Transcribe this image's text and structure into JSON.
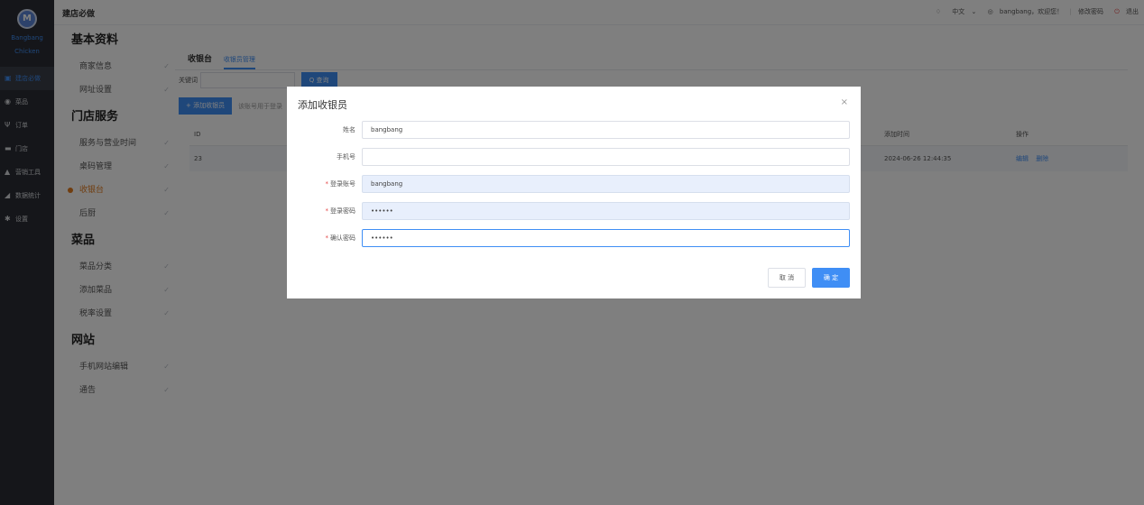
{
  "nav": {
    "brand_mark": "M",
    "brand_name_1": "Bangbang",
    "brand_name_2": "Chicken",
    "items": [
      {
        "icon": "clipboard-icon",
        "glyph": "▣",
        "label": "建店必做"
      },
      {
        "icon": "dish-icon",
        "glyph": "◉",
        "label": "菜品"
      },
      {
        "icon": "utensils-icon",
        "glyph": "Ψ",
        "label": "订单"
      },
      {
        "icon": "store-icon",
        "glyph": "▬",
        "label": "门店"
      },
      {
        "icon": "thumbs-up-icon",
        "glyph": "▲",
        "label": "营销工具"
      },
      {
        "icon": "stats-icon",
        "glyph": "◢",
        "label": "数据统计"
      },
      {
        "icon": "gear-icon",
        "glyph": "✱",
        "label": "设置"
      }
    ]
  },
  "topbar": {
    "title": "建店必做",
    "bell_glyph": "♢",
    "language": "中文",
    "chevron_glyph": "⌄",
    "user_glyph": "◎",
    "greeting": "bangbang，欢迎您！",
    "separator": "|",
    "change_password": "修改密码",
    "logout_glyph": "⏻",
    "logout": "退出"
  },
  "submenu": {
    "check_glyph": "✓",
    "groups": [
      {
        "title": "基本资料",
        "items": [
          "商家信息",
          "网址设置"
        ]
      },
      {
        "title": "门店服务",
        "items": [
          "服务与营业时间",
          "桌码管理",
          "收银台",
          "后厨"
        ]
      },
      {
        "title": "菜品",
        "items": [
          "菜品分类",
          "添加菜品",
          "税率设置"
        ]
      },
      {
        "title": "网站",
        "items": [
          "手机网站编辑",
          "通告"
        ]
      }
    ]
  },
  "main": {
    "tab_1": "收银台",
    "tab_2": "收银员管理",
    "search_label": "关键词",
    "search_button": "Q 查询",
    "add_button": "+  添加收银员",
    "add_tip": "该账号用于登录",
    "table": {
      "col_id": "ID",
      "col_time": "添加时间",
      "col_op": "操作",
      "row_id": "23",
      "row_time": "2024-06-26 12:44:35",
      "row_edit": "编辑",
      "row_delete": "删除"
    }
  },
  "dialog": {
    "title": "添加收银员",
    "close_glyph": "×",
    "required_mark": "*",
    "fields": {
      "name": {
        "label": "姓名",
        "value": "bangbang"
      },
      "phone": {
        "label": "手机号",
        "value": ""
      },
      "account": {
        "label": "登录账号",
        "value": "bangbang"
      },
      "password": {
        "label": "登录密码",
        "value": "••••••"
      },
      "confirm": {
        "label": "确认密码",
        "value": "••••••"
      }
    },
    "cancel": "取 消",
    "ok": "确 定"
  },
  "colors": {
    "accent": "#3f8ef5",
    "active_menu": "#e07b1f",
    "nav_bg": "#2a2d35"
  }
}
